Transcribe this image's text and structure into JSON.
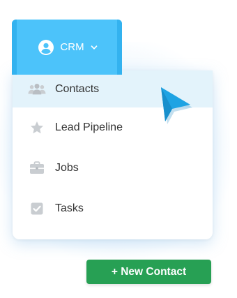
{
  "crm_tab": {
    "label": "CRM",
    "icon": "user-circle-icon",
    "caret_icon": "chevron-down-icon"
  },
  "menu": {
    "items": [
      {
        "label": "Contacts",
        "icon": "people-icon",
        "active": true
      },
      {
        "label": "Lead Pipeline",
        "icon": "star-icon",
        "active": false
      },
      {
        "label": "Jobs",
        "icon": "briefcase-icon",
        "active": false
      },
      {
        "label": "Tasks",
        "icon": "checkbox-icon",
        "active": false
      }
    ]
  },
  "new_contact_button": {
    "label": "+ New Contact"
  },
  "colors": {
    "tab_bg": "#4cc3fa",
    "tab_edge": "#33b2ef",
    "active_item_bg": "#e3f3fb",
    "button_bg": "#27a054",
    "cursor": "#1ea3e3",
    "icon_gray": "#c9cdd1"
  }
}
